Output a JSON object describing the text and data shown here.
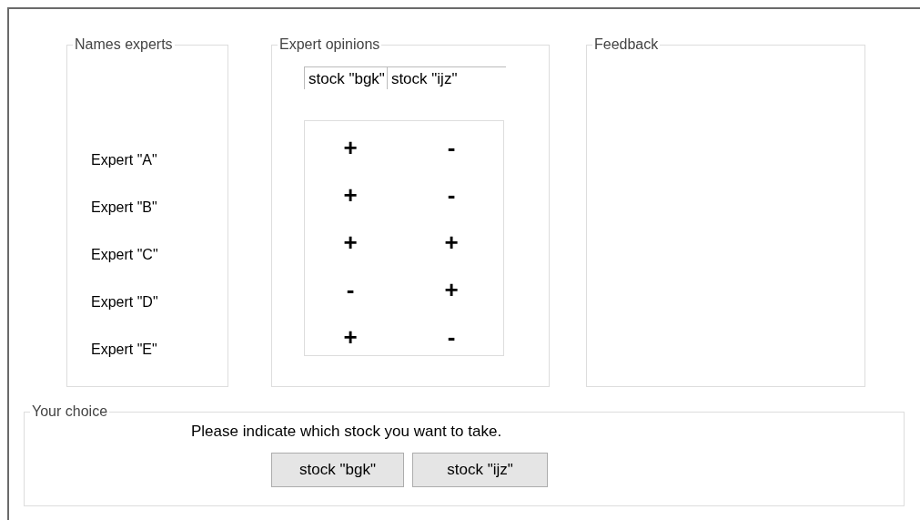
{
  "names_experts": {
    "legend": "Names experts",
    "experts": [
      "Expert \"A\"",
      "Expert \"B\"",
      "Expert \"C\"",
      "Expert \"D\"",
      "Expert \"E\""
    ]
  },
  "expert_opinions": {
    "legend": "Expert opinions",
    "columns": [
      "stock \"bgk\"",
      "stock \"ijz\""
    ],
    "rows": [
      [
        "+",
        "-"
      ],
      [
        "+",
        "-"
      ],
      [
        "+",
        "+"
      ],
      [
        "-",
        "+"
      ],
      [
        "+",
        "-"
      ]
    ]
  },
  "feedback": {
    "legend": "Feedback"
  },
  "your_choice": {
    "legend": "Your choice",
    "prompt": "Please indicate which stock you want to take.",
    "buttons": [
      "stock \"bgk\"",
      "stock \"ijz\""
    ]
  }
}
